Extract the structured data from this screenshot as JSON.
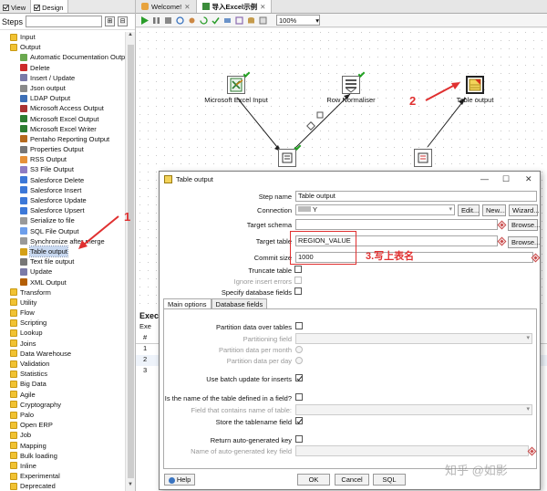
{
  "left_tabs": [
    "View",
    "Design"
  ],
  "steps_header": {
    "title": "Steps",
    "search_placeholder": ""
  },
  "tree": [
    {
      "label": "Input",
      "kind": "cat"
    },
    {
      "label": "Output",
      "kind": "cat"
    },
    {
      "label": "Automatic Documentation Output",
      "kind": "sub",
      "color": "#6aa84f"
    },
    {
      "label": "Delete",
      "kind": "sub",
      "color": "#cc2b2b"
    },
    {
      "label": "Insert / Update",
      "kind": "sub",
      "color": "#7a7aa8"
    },
    {
      "label": "Json output",
      "kind": "sub",
      "color": "#8a8a8a"
    },
    {
      "label": "LDAP Output",
      "kind": "sub",
      "color": "#3d6fb6"
    },
    {
      "label": "Microsoft Access Output",
      "kind": "sub",
      "color": "#a33"
    },
    {
      "label": "Microsoft Excel Output",
      "kind": "sub",
      "color": "#2e7d32"
    },
    {
      "label": "Microsoft Excel Writer",
      "kind": "sub",
      "color": "#2e7d32"
    },
    {
      "label": "Pentaho Reporting Output",
      "kind": "sub",
      "color": "#b56a1e"
    },
    {
      "label": "Properties Output",
      "kind": "sub",
      "color": "#777"
    },
    {
      "label": "RSS Output",
      "kind": "sub",
      "color": "#e69138"
    },
    {
      "label": "S3 File Output",
      "kind": "sub",
      "color": "#8e7cc3"
    },
    {
      "label": "Salesforce Delete",
      "kind": "sub",
      "color": "#3c78d8"
    },
    {
      "label": "Salesforce Insert",
      "kind": "sub",
      "color": "#3c78d8"
    },
    {
      "label": "Salesforce Update",
      "kind": "sub",
      "color": "#3c78d8"
    },
    {
      "label": "Salesforce Upsert",
      "kind": "sub",
      "color": "#3c78d8"
    },
    {
      "label": "Serialize to file",
      "kind": "sub",
      "color": "#999"
    },
    {
      "label": "SQL File Output",
      "kind": "sub",
      "color": "#6d9eeb"
    },
    {
      "label": "Synchronize after merge",
      "kind": "sub",
      "color": "#999"
    },
    {
      "label": "Table output",
      "kind": "sub",
      "color": "#d4a017",
      "selected": true
    },
    {
      "label": "Text file output",
      "kind": "sub",
      "color": "#777"
    },
    {
      "label": "Update",
      "kind": "sub",
      "color": "#7a7aa8"
    },
    {
      "label": "XML Output",
      "kind": "sub",
      "color": "#b45f06"
    },
    {
      "label": "Transform",
      "kind": "cat"
    },
    {
      "label": "Utility",
      "kind": "cat"
    },
    {
      "label": "Flow",
      "kind": "cat"
    },
    {
      "label": "Scripting",
      "kind": "cat"
    },
    {
      "label": "Lookup",
      "kind": "cat"
    },
    {
      "label": "Joins",
      "kind": "cat"
    },
    {
      "label": "Data Warehouse",
      "kind": "cat"
    },
    {
      "label": "Validation",
      "kind": "cat"
    },
    {
      "label": "Statistics",
      "kind": "cat"
    },
    {
      "label": "Big Data",
      "kind": "cat"
    },
    {
      "label": "Agile",
      "kind": "cat"
    },
    {
      "label": "Cryptography",
      "kind": "cat"
    },
    {
      "label": "Palo",
      "kind": "cat"
    },
    {
      "label": "Open ERP",
      "kind": "cat"
    },
    {
      "label": "Job",
      "kind": "cat"
    },
    {
      "label": "Mapping",
      "kind": "cat"
    },
    {
      "label": "Bulk loading",
      "kind": "cat"
    },
    {
      "label": "Inline",
      "kind": "cat"
    },
    {
      "label": "Experimental",
      "kind": "cat"
    },
    {
      "label": "Deprecated",
      "kind": "cat"
    }
  ],
  "editor_tabs": [
    "Welcome!",
    "导入Excel示例"
  ],
  "zoom": "100%",
  "canvas": {
    "nodes": [
      "Microsoft Excel Input",
      "Row Normaliser",
      "Table output"
    ]
  },
  "exec": {
    "title": "Execu",
    "sub": "Exe",
    "col": "#",
    "rows": [
      "1",
      "2",
      "3"
    ]
  },
  "annotations": {
    "a1": "1",
    "a2": "2",
    "a3": "3.写上表名"
  },
  "watermark": "知乎 @如影",
  "dialog": {
    "title": "Table output",
    "controls": {
      "min": "—",
      "max": "☐",
      "close": "✕"
    },
    "step_name_label": "Step name",
    "step_name_value": "Table output",
    "connection_label": "Connection",
    "connection_value": "Y",
    "edit": "Edit...",
    "new": "New...",
    "wizard": "Wizard...",
    "target_schema_label": "Target schema",
    "target_schema_value": "",
    "browse": "Browse...",
    "target_table_label": "Target table",
    "target_table_value": "REGION_VALUE",
    "commit_label": "Commit size",
    "commit_value": "1000",
    "truncate_label": "Truncate table",
    "ignore_label": "Ignore insert errors",
    "specify_label": "Specify database fields",
    "tabs": [
      "Main options",
      "Database fields"
    ],
    "partition_label": "Partition data over tables",
    "partitioning_field_label": "Partitioning field",
    "per_month_label": "Partition data per month",
    "per_day_label": "Partition data per day",
    "batch_label": "Use batch update for inserts",
    "name_in_field_label": "Is the name of the table defined in a field?",
    "field_name_label": "Field that contains name of table:",
    "store_name_label": "Store the tablename field",
    "return_key_label": "Return auto-generated key",
    "key_field_label": "Name of auto-generated key field",
    "help": "Help",
    "ok": "OK",
    "cancel": "Cancel",
    "sql": "SQL"
  },
  "colors": {
    "annotation": "#e03030",
    "selection": "#c8d8f0",
    "hop": "#222"
  }
}
